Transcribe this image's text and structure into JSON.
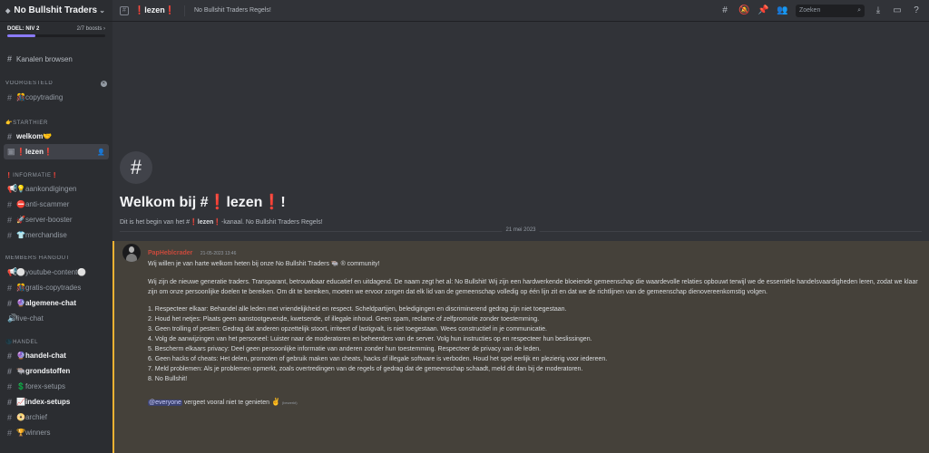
{
  "server": {
    "name": "No Bullshit Traders",
    "boost_goal": "DOEL: NIV 2",
    "boost_count": "2/7 boosts",
    "boost_progress": 0.29
  },
  "sidebar": {
    "browse_label": "Kanalen browsen",
    "suggested": {
      "title": "VOORGESTELD",
      "items": [
        {
          "label": "copytrading",
          "emoji": "🎊"
        }
      ]
    },
    "categories": [
      {
        "title": "STARTHIER",
        "emoji": "👉",
        "channels": [
          {
            "label": "welkom",
            "emoji": "🤝"
          },
          {
            "label": "lezen",
            "emoji": "❗"
          }
        ]
      },
      {
        "title": "INFORMATIE",
        "emoji": "❗",
        "channels": [
          {
            "label": "aankondigingen",
            "emoji": "💡"
          },
          {
            "label": "anti-scammer",
            "emoji": "⛔"
          },
          {
            "label": "server-booster",
            "emoji": "🚀"
          },
          {
            "label": "merchandise",
            "emoji": "👕"
          }
        ]
      },
      {
        "title": "MEMBERS HANGOUT",
        "emoji": "",
        "channels": [
          {
            "label": "youtube-content",
            "emoji": "⚪"
          },
          {
            "label": "gratis-copytrades",
            "emoji": "🎊"
          },
          {
            "label": "algemene-chat",
            "emoji": "🔮"
          },
          {
            "label": "live-chat",
            "emoji": ""
          }
        ]
      },
      {
        "title": "HANDEL",
        "emoji": "🌑",
        "channels": [
          {
            "label": "handel-chat",
            "emoji": "🔮"
          },
          {
            "label": "grondstoffen",
            "emoji": "🐃"
          },
          {
            "label": "forex-setups",
            "emoji": "💲"
          },
          {
            "label": "index-setups",
            "emoji": "📈"
          },
          {
            "label": "archief",
            "emoji": "📀"
          },
          {
            "label": "winners",
            "emoji": "🏆"
          }
        ]
      }
    ]
  },
  "topbar": {
    "channel_name": "lezen",
    "channel_emoji": "❗",
    "topic": "No Bullshit Traders Regels!",
    "search_placeholder": "Zoeken"
  },
  "welcome": {
    "title_prefix": "Welkom bij #",
    "title_emoji": "❗",
    "title_channel": "lezen",
    "title_suffix": "!",
    "desc_prefix": "Dit is het begin van het #",
    "desc_channel": "lezen",
    "desc_suffix": "-kanaal. No Bullshit Traders Regels!"
  },
  "date_divider": "21 mei 2023",
  "message": {
    "author": "PapHeblcrader",
    "timestamp": "21-05-2023 13:46",
    "intro": "Wij willen je van harte welkom heten bij onze No Bullshit Traders 🐃 ® community!",
    "paragraph": "Wij zijn de nieuwe generatie traders. Transparant, betrouwbaar educatief en uitdagend. De naam zegt het al: No Bullshit! Wij zijn een hardwerkende bloeiende gemeenschap die waardevolle relaties opbouwt terwijl we de essentiële handelsvaardigheden leren, zodat we klaar zijn om onze persoonlijke doelen te bereiken. Om dit te bereiken, moeten we ervoor zorgen dat elk lid van de gemeenschap volledig op één lijn zit en dat we de richtlijnen van de gemeenschap dienovereenkomstig volgen.",
    "rules": [
      "1. Respecteer elkaar: Behandel alle leden met vriendelijkheid en respect. Scheldpartijen, beledigingen en discriminerend gedrag zijn niet toegestaan.",
      "2. Houd het netjes: Plaats geen aanstootgevende, kwetsende, of illegale inhoud. Geen spam, reclame of zelfpromotie zonder toestemming.",
      "3. Geen trolling of pesten: Gedrag dat anderen opzettelijk stoort, irriteert of lastigvalt, is niet toegestaan. Wees constructief in je communicatie.",
      "4. Volg de aanwijzingen van het personeel: Luister naar de moderatoren en beheerders van de server. Volg hun instructies op en respecteer hun beslissingen.",
      "5. Bescherm elkaars privacy: Deel geen persoonlijke informatie van anderen zonder hun toestemming. Respecteer de privacy van de leden.",
      "6. Geen hacks of cheats: Het delen, promoten of gebruik maken van cheats, hacks of illegale software is verboden. Houd het spel eerlijk en plezierig voor iedereen.",
      "7. Meld problemen: Als je problemen opmerkt, zoals overtredingen van de regels of gedrag dat de gemeenschap schaadt, meld dit dan bij de moderatoren.",
      "8. No Bullshit!"
    ],
    "mention": "@everyone",
    "closing": " vergeet vooral niet te genieten ",
    "closing_emoji": "✌",
    "edited": "(bewerkt)"
  },
  "colors": {
    "accent_red": "#ed4245",
    "highlight_bg": "#45413a",
    "highlight_border": "#f0b232"
  }
}
